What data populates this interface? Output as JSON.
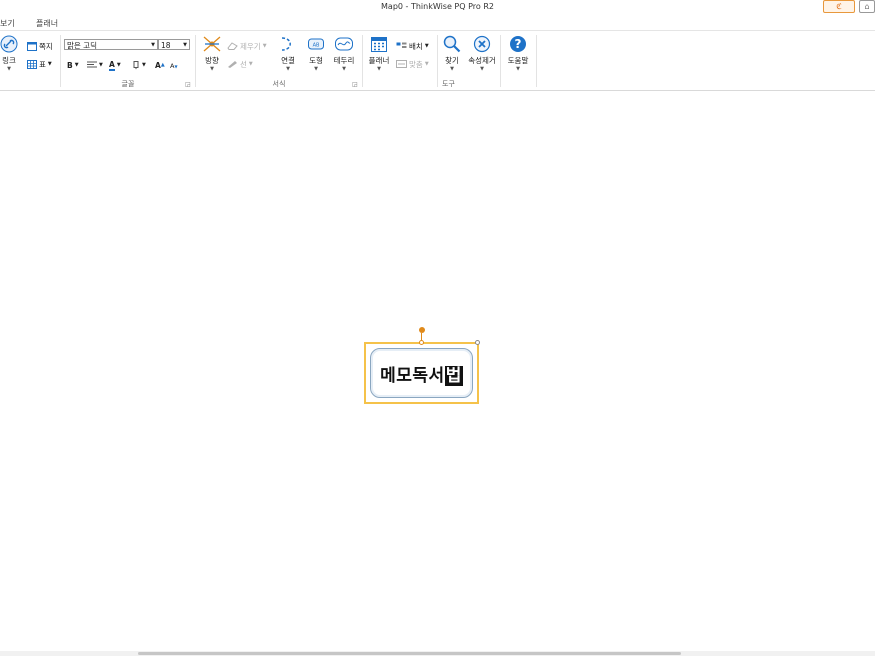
{
  "window": {
    "title": "Map0 - ThinkWise PQ Pro R2",
    "buttons": [
      {
        "name": "ribbon-toggle",
        "glyph": "ℭ"
      },
      {
        "name": "home",
        "glyph": "⌂"
      }
    ]
  },
  "menu": {
    "items": [
      "보기",
      "플래너"
    ]
  },
  "ribbon": {
    "insert": {
      "link_label": "링크",
      "note_label": "쪽지",
      "table_label": "표"
    },
    "font": {
      "group_label": "글꼴",
      "font_name": "맑은 고딕",
      "font_size": "18",
      "bold_label": "B",
      "color_label": "A",
      "grow_label": "A",
      "shrink_label": "A"
    },
    "format": {
      "group_label": "서식",
      "direction_label": "방향",
      "remove_label": "제우기",
      "line_label": "선",
      "connect_label": "연결",
      "shape_label": "도형",
      "border_label": "테두리"
    },
    "tools": {
      "group_label": "도구",
      "planner_label": "플래너",
      "arrange_label": "배치",
      "fit_label": "맞춤",
      "find_label": "찾기",
      "clear_format_label": "속성제거",
      "help_label": "도움말"
    },
    "colors": {
      "accent_blue": "#1e72c8",
      "selection_yellow": "#f5c24a",
      "handle_orange": "#e08a1a"
    }
  },
  "map": {
    "central_topic": {
      "text": "메모독서",
      "selected_char": "법"
    }
  }
}
